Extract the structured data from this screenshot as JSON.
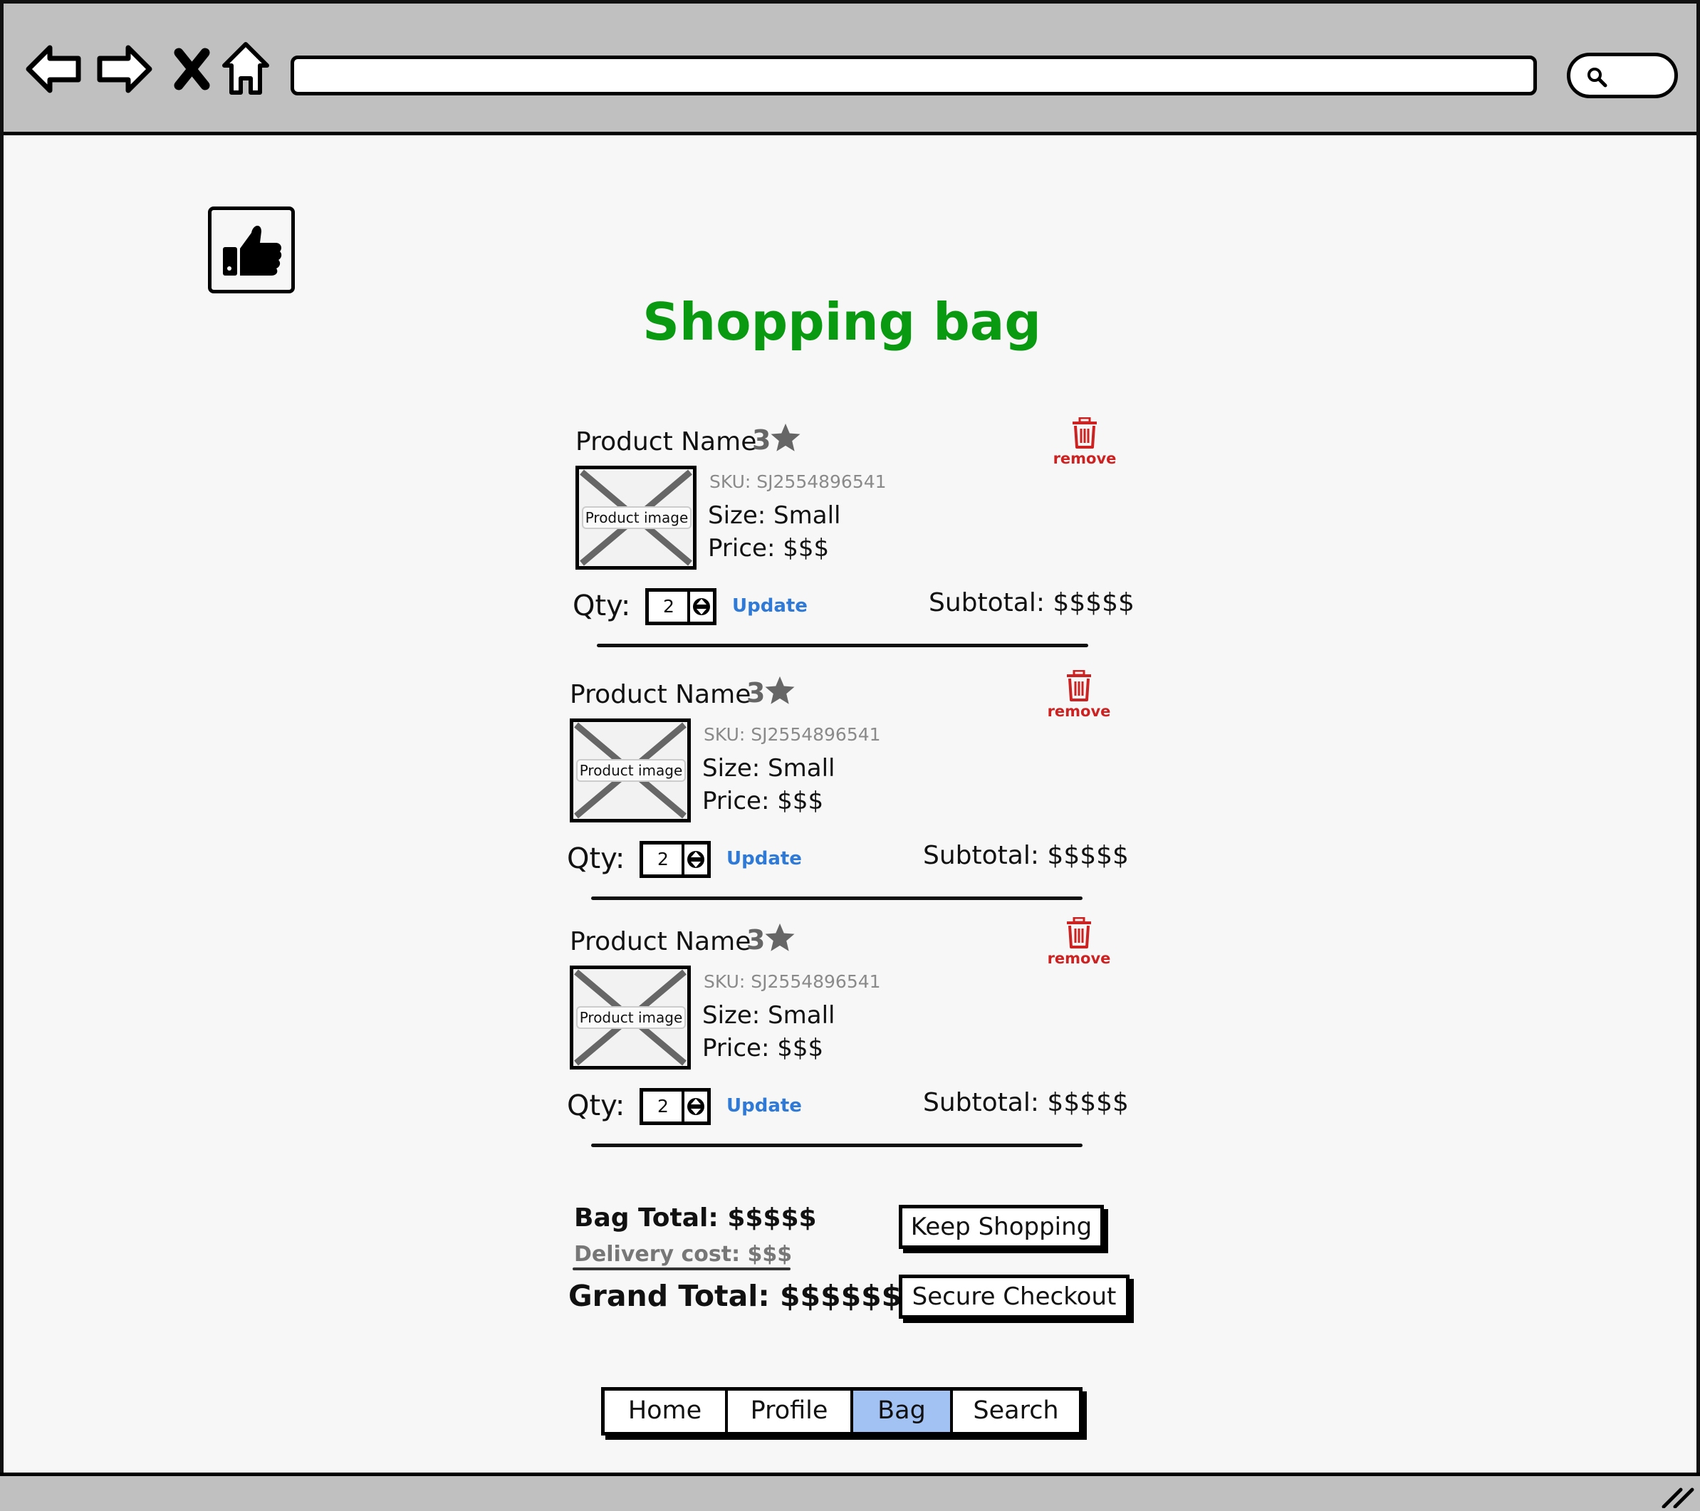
{
  "page": {
    "title": "Shopping bag"
  },
  "items": [
    {
      "name": "Product Name",
      "rating": "3",
      "remove_label": "remove",
      "image_label": "Product image",
      "sku": "SKU: SJ2554896541",
      "size": "Size: Small",
      "price": "Price: $$$",
      "qty_label": "Qty:",
      "qty_value": "2",
      "update_label": "Update",
      "subtotal": "Subtotal: $$$$$"
    },
    {
      "name": "Product Name",
      "rating": "3",
      "remove_label": "remove",
      "image_label": "Product image",
      "sku": "SKU: SJ2554896541",
      "size": "Size: Small",
      "price": "Price: $$$",
      "qty_label": "Qty:",
      "qty_value": "2",
      "update_label": "Update",
      "subtotal": "Subtotal: $$$$$"
    },
    {
      "name": "Product Name",
      "rating": "3",
      "remove_label": "remove",
      "image_label": "Product image",
      "sku": "SKU: SJ2554896541",
      "size": "Size: Small",
      "price": "Price: $$$",
      "qty_label": "Qty:",
      "qty_value": "2",
      "update_label": "Update",
      "subtotal": "Subtotal: $$$$$"
    }
  ],
  "totals": {
    "bag_total": "Bag Total: $$$$$",
    "delivery_cost": "Delivery cost: $$$",
    "grand_total": "Grand Total: $$$$$$"
  },
  "actions": {
    "keep_shopping": "Keep Shopping",
    "secure_checkout": "Secure Checkout"
  },
  "tabs": [
    {
      "label": "Home",
      "active": false
    },
    {
      "label": "Profile",
      "active": false
    },
    {
      "label": "Bag",
      "active": true
    },
    {
      "label": "Search",
      "active": false
    }
  ],
  "icons": {
    "back": "back-arrow-icon",
    "forward": "forward-arrow-icon",
    "stop": "close-icon",
    "home": "home-icon",
    "search": "search-icon",
    "logo": "thumbs-up-icon",
    "rating": "star-icon",
    "remove": "trash-icon",
    "stepper": "spinner-arrows-icon"
  },
  "colors": {
    "title": "#0a9a12",
    "remove": "#cc2222",
    "link": "#2f7ad6",
    "active_tab": "#a3c2f4",
    "chrome": "#c0c0c0"
  }
}
